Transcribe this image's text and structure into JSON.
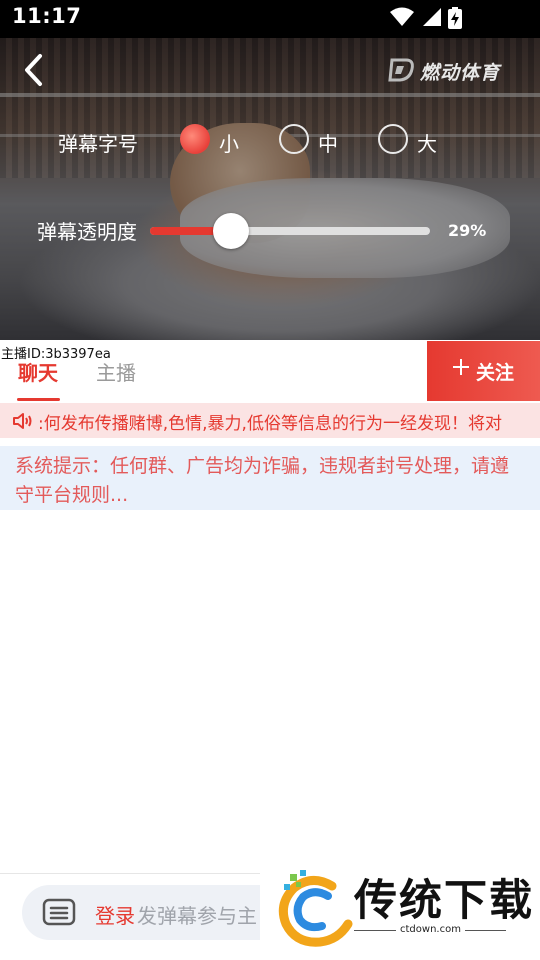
{
  "status_bar": {
    "time": "11:17",
    "icons": [
      "wifi-icon",
      "signal-icon",
      "battery-charging-icon"
    ]
  },
  "video": {
    "watermark": "燃动体育",
    "danmaku_settings": {
      "font_size_label": "弹幕字号",
      "font_size_options": [
        "小",
        "中",
        "大"
      ],
      "font_size_selected": "小",
      "opacity_label": "弹幕透明度",
      "opacity_value_text": "29%",
      "opacity_fraction": 0.29
    }
  },
  "anchor": {
    "id_text": "主播ID:3b3397ea"
  },
  "tabs": [
    {
      "label": "聊天",
      "active": true
    },
    {
      "label": "主播",
      "active": false
    }
  ],
  "follow_button": {
    "label": "关注"
  },
  "notice": {
    "text": ":何发布传播赌博,色情,暴力,低俗等信息的行为一经发现！将对"
  },
  "system_tip": {
    "text": "系统提示：任何群、广告均为诈骗，违规者封号处理，请遵守平台规则..."
  },
  "input_bar": {
    "login_label": "登录",
    "hint_text": "发弹幕参与主"
  },
  "overlay_logo": {
    "brand": "传统下载",
    "domain": "ctdown.com"
  },
  "colors": {
    "accent": "#e53930",
    "notice_bg": "#fbe3e3",
    "tip_bg": "#e9f1fb"
  }
}
